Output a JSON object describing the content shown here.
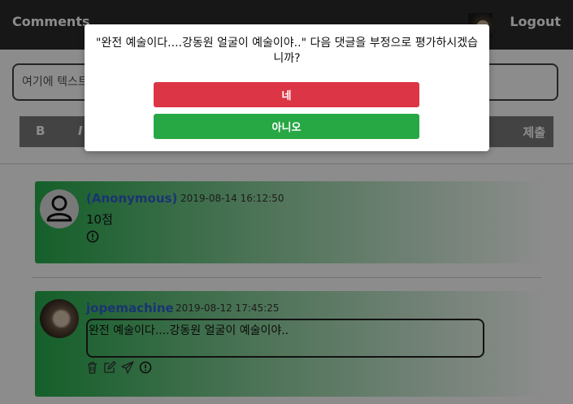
{
  "header": {
    "brand": "Comments",
    "logout_label": "Logout"
  },
  "composer": {
    "placeholder": "여기에 텍스트를 입력하세요",
    "toolbar": {
      "bold": "B",
      "italic": "I",
      "submit": "제출"
    }
  },
  "comments": [
    {
      "author": "(Anonymous)",
      "date": "2019-08-14 16:12:50",
      "text": "10점",
      "color": "#27ae4d"
    },
    {
      "author": "jopemachine",
      "date": "2019-08-12 17:45:25",
      "text": "완전 예술이다....강동원 얼굴이 예술이야..",
      "color": "#27ae4d"
    }
  ],
  "modal": {
    "message": "\"완전 예술이다....강동원 얼굴이 예술이야..\" 다음 댓글을 부정으로 평가하시겠습니까?",
    "yes_label": "네",
    "no_label": "아니오",
    "yes_color": "#dc3545",
    "no_color": "#28a745"
  },
  "icons": [
    "user-icon",
    "alert-icon",
    "trash-icon",
    "edit-icon",
    "send-icon"
  ]
}
